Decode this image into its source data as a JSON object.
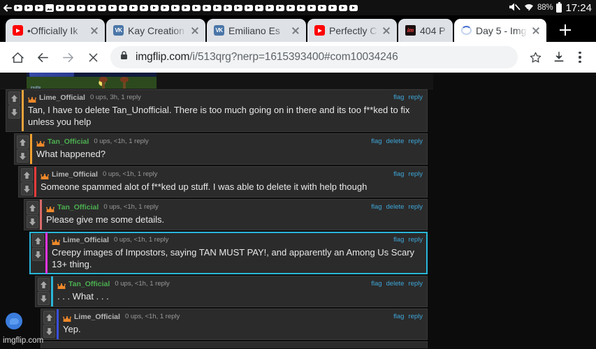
{
  "status_bar": {
    "notification_icons": [
      "back-arrow-icon",
      "youtube-icon",
      "youtube-icon",
      "youtube-icon",
      "image-icon",
      "youtube-icon",
      "youtube-icon",
      "youtube-icon",
      "youtube-icon",
      "youtube-icon",
      "youtube-icon",
      "youtube-icon",
      "youtube-icon",
      "youtube-icon",
      "youtube-icon",
      "youtube-icon",
      "youtube-icon",
      "youtube-icon",
      "youtube-icon",
      "youtube-icon",
      "youtube-icon",
      "youtube-icon",
      "youtube-icon",
      "youtube-icon",
      "youtube-icon",
      "youtube-icon",
      "youtube-icon",
      "youtube-icon",
      "youtube-icon",
      "youtube-icon",
      "youtube-icon",
      "youtube-icon",
      "youtube-icon",
      "youtube-icon"
    ],
    "mute_icon": "volume-muted-icon",
    "wifi_icon": "wifi-icon",
    "battery_percent": "88%",
    "battery_icon": "battery-full-icon",
    "clock": "17:24"
  },
  "tabs": [
    {
      "title": "•Officially Ik",
      "favicon": "youtube-favicon",
      "favicon_text": "",
      "active": false
    },
    {
      "title": "Kay Creation",
      "favicon": "vk-favicon",
      "favicon_text": "VK",
      "active": false
    },
    {
      "title": "Emiliano Es",
      "favicon": "vk-favicon",
      "favicon_text": "VK",
      "active": false
    },
    {
      "title": "Perfectly Cu",
      "favicon": "youtube-favicon",
      "favicon_text": "",
      "active": false
    },
    {
      "title": "404 P",
      "favicon": "imgflip-favicon",
      "favicon_text": "im",
      "active": false
    },
    {
      "title": "Day 5 - Imgf",
      "favicon": "loading-spinner",
      "favicon_text": "",
      "active": true
    }
  ],
  "tab_close_label": "×",
  "new_tab_label": "+",
  "toolbar": {
    "home_icon": "home-icon",
    "back_icon": "back-arrow-icon",
    "forward_icon": "forward-arrow-icon",
    "stop_icon": "stop-loading-icon",
    "lock_icon": "lock-icon",
    "url_domain": "imgflip.com",
    "url_path": "/i/513qrg?nerp=1615393400#com10034246",
    "bookmark_icon": "star-icon",
    "download_icon": "download-icon",
    "menu_icon": "kebab-menu-icon"
  },
  "page": {
    "watermark": "imgflip.com",
    "chat_fab": "chat-bubble-icon",
    "vote_up_icon": "upvote-arrow-icon",
    "vote_down_icon": "downvote-arrow-icon",
    "crown_icon": "crown-icon",
    "comments": [
      {
        "username": "Lime_Official",
        "user_class": "lime",
        "badge": "crown-icon",
        "stats": "0 ups, 3h, 1 reply",
        "actions": [
          "flag",
          "reply"
        ],
        "text": "Tan, I have to delete Tan_Unofficial. There is too much going on in there and its too f**ked to fix unless you help",
        "accent_color": "#e8a33d",
        "indent": 0,
        "highlighted": false
      },
      {
        "username": "Tan_Official",
        "user_class": "tan",
        "badge": "crown-icon",
        "stats": "0 ups, <1h, 1 reply",
        "actions": [
          "flag",
          "delete",
          "reply"
        ],
        "text": "What happened?",
        "accent_color": "#f0a030",
        "indent": 1,
        "highlighted": false
      },
      {
        "username": "Lime_Official",
        "user_class": "lime",
        "badge": "crown-icon",
        "stats": "0 ups, <1h, 1 reply",
        "actions": [
          "flag",
          "reply"
        ],
        "text": "Someone spammed alot of f**ked up stuff. I was able to delete it with help though",
        "accent_color": "#e83b3b",
        "indent": 2,
        "highlighted": false
      },
      {
        "username": "Tan_Official",
        "user_class": "tan",
        "badge": "crown-icon",
        "stats": "0 ups, <1h, 1 reply",
        "actions": [
          "flag",
          "delete",
          "reply"
        ],
        "text": "Please give me some details.",
        "accent_color": "#d86a6a",
        "indent": 3,
        "highlighted": false
      },
      {
        "username": "Lime_Official",
        "user_class": "lime",
        "badge": "crown-icon",
        "stats": "0 ups, <1h, 1 reply",
        "actions": [
          "flag",
          "reply"
        ],
        "text": "Creepy images of Impostors, saying TAN MUST PAY!, and apparently an Among Us Scary 13+ thing.",
        "accent_color": "#e234e2",
        "indent": 4,
        "highlighted": true
      },
      {
        "username": "Tan_Official",
        "user_class": "tan",
        "badge": "crown-icon",
        "stats": "0 ups, <1h, 1 reply",
        "actions": [
          "flag",
          "delete",
          "reply"
        ],
        "text": ". . . What . . .",
        "accent_color": "#29b6d8",
        "indent": 5,
        "highlighted": false
      },
      {
        "username": "Lime_Official",
        "user_class": "lime",
        "badge": "crown-icon",
        "stats": "0 ups, <1h, 1 reply",
        "actions": [
          "flag",
          "reply"
        ],
        "text": "Yep.",
        "accent_color": "#3b4fdd",
        "indent": 6,
        "highlighted": false
      }
    ]
  }
}
